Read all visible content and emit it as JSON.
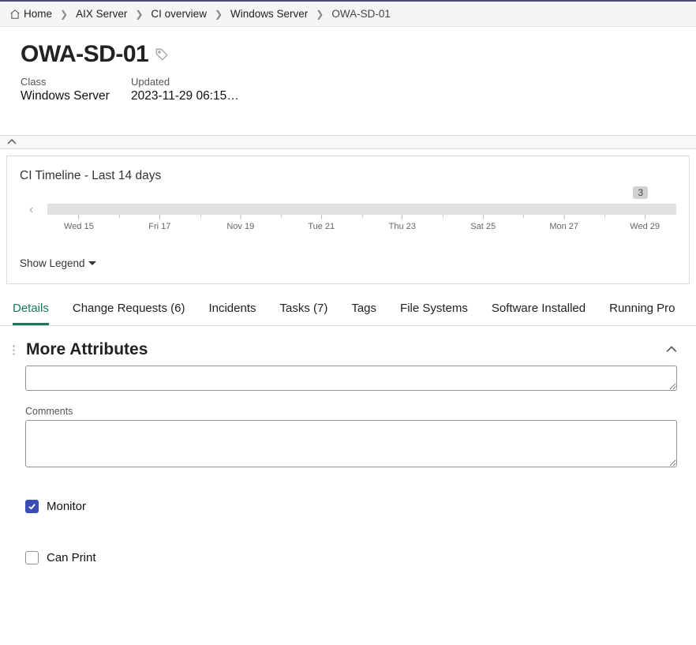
{
  "breadcrumb": {
    "home": "Home",
    "items": [
      "AIX Server",
      "CI overview",
      "Windows Server"
    ],
    "current": "OWA-SD-01"
  },
  "header": {
    "title": "OWA-SD-01",
    "meta": {
      "class_label": "Class",
      "class_value": "Windows Server",
      "updated_label": "Updated",
      "updated_value": "2023-11-29 06:15…"
    }
  },
  "timeline": {
    "title": "CI Timeline - Last 14 days",
    "badge": "3",
    "ticks": [
      "Wed 15",
      "Fri 17",
      "Nov 19",
      "Tue 21",
      "Thu 23",
      "Sat 25",
      "Mon 27",
      "Wed 29"
    ],
    "show_legend": "Show Legend"
  },
  "tabs": {
    "details": "Details",
    "change_requests": "Change Requests (6)",
    "incidents": "Incidents",
    "tasks": "Tasks (7)",
    "tags": "Tags",
    "file_systems": "File Systems",
    "software": "Software Installed",
    "running": "Running Pro"
  },
  "section": {
    "title": "More Attributes",
    "comments_label": "Comments",
    "monitor_label": "Monitor",
    "can_print_label": "Can Print"
  }
}
